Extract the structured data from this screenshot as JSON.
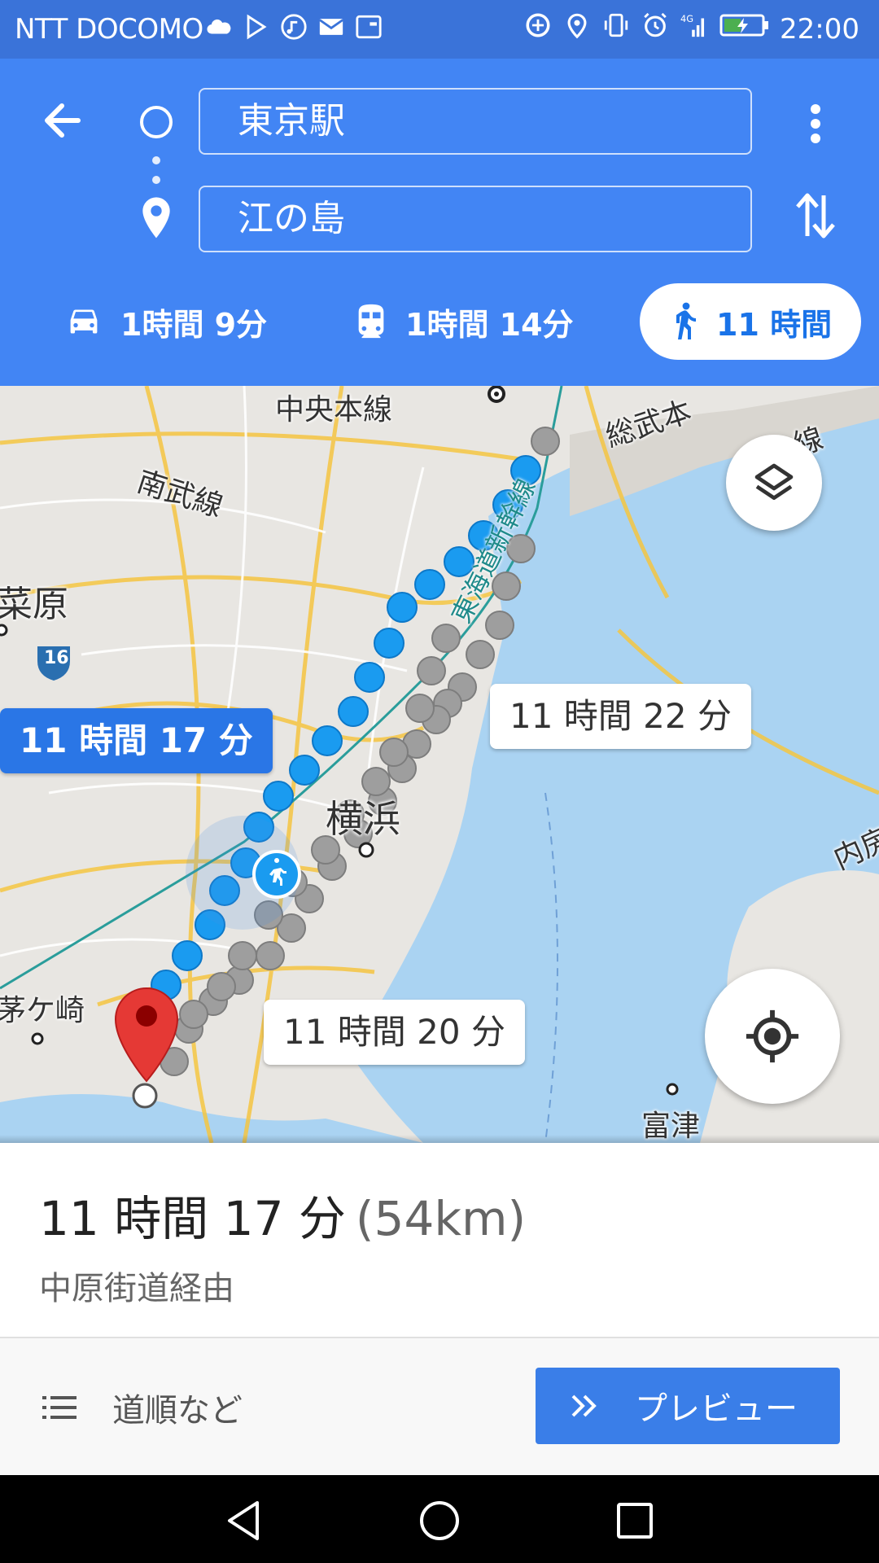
{
  "status_bar": {
    "carrier": "NTT DOCOMO",
    "time": "22:00",
    "left_icons": [
      "cloud-icon",
      "play-store-icon",
      "music-icon",
      "mail-icon",
      "maps-icon"
    ],
    "right_icons": [
      "data-saver-icon",
      "location-icon",
      "vibrate-icon",
      "alarm-icon",
      "signal-4g-icon",
      "battery-charging-icon"
    ],
    "colors": {
      "background": "#3a73d9"
    }
  },
  "header": {
    "origin": "東京駅",
    "destination": "江の島",
    "colors": {
      "background": "#4285f4"
    }
  },
  "travel_modes": [
    {
      "icon": "car-icon",
      "label": "1時間 9分",
      "selected": false
    },
    {
      "icon": "train-icon",
      "label": "1時間 14分",
      "selected": false
    },
    {
      "icon": "walk-icon",
      "label": "11 時間",
      "selected": true
    }
  ],
  "map": {
    "labels": {
      "chuo_line": "中央本線",
      "sobu_line": "総武本",
      "sen": "線",
      "nambu_line": "南武線",
      "hara": "菜原",
      "route_16": "16",
      "yokohama": "横浜",
      "chigasaki": "茅ケ崎",
      "futtsu": "富津",
      "uchibo": "内房",
      "shinkansen": "東海道新幹線"
    },
    "route_pills": {
      "selected": "11 時間 17 分",
      "alt_1": "11 時間 22 分",
      "alt_2": "11 時間 20 分"
    },
    "colors": {
      "route_active": "#1a9bf0",
      "route_alt": "#9e9e9e",
      "water": "#aad3f2",
      "land": "#e8e6e2",
      "pin": "#e53935"
    }
  },
  "summary": {
    "duration": "11 時間 17 分",
    "distance": "(54km)",
    "via": "中原街道経由"
  },
  "actions": {
    "steps_label": "道順など",
    "preview_label": "プレビュー"
  }
}
